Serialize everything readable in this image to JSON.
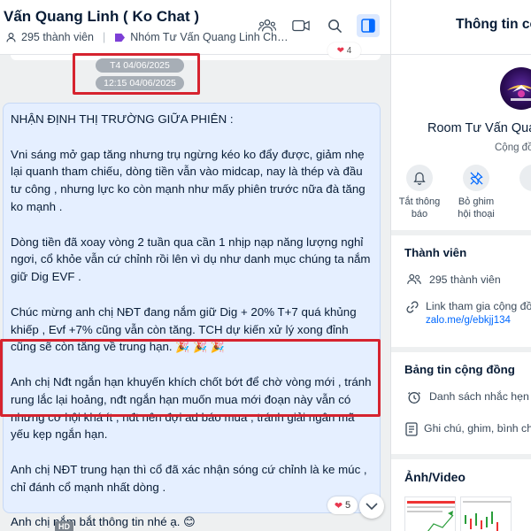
{
  "chat": {
    "title": "Vấn Quang Linh ( Ko Chat )",
    "member_count": "295 thành viên",
    "group_name": "Nhóm Tư Vấn Quang Linh Chứn...",
    "previous_message_reactions": "4",
    "timestamps": [
      "T4 04/06/2025",
      "12:15 04/06/2025"
    ],
    "message": {
      "paragraphs": [
        "NHẬN ĐỊNH THỊ TRƯỜNG GIỮA PHIÊN :",
        "Vni sáng mở gap tăng nhưng trụ ngừng kéo ko đẩy được, giảm nhẹ lại quanh tham chiếu, dòng tiền vẫn vào midcap, nay là thép và đầu tư công , nhưng lực ko còn mạnh như mấy phiên trước nữa đà tăng ko mạnh .",
        "Dòng tiền đã xoay vòng 2 tuần qua cần 1 nhịp nạp năng lượng nghỉ ngơi, cổ khỏe vẫn cứ chỉnh rồi lên vì dụ như danh mục chúng ta nắm giữ Dig EVF .",
        "Chúc mừng anh chị NĐT đang nắm giữ Dig + 20% T+7 quá khủng khiếp , Evf +7% cũng vẫn còn tăng. TCH dự kiến xử lý xong đỉnh cũng sẽ còn tăng về trung hạn.",
        "Anh chị Nđt ngắn hạn khuyến khích chốt bớt để chờ vòng mới , tránh rung lắc lại hoảng, nđt ngắn hạn muốn mua mới đoạn này vẫn có nhưng cơ hội khá ít , nđt nên đợi ad báo mua , tránh giải ngân mã yếu kẹp ngắn hạn.",
        "Anh chị NĐT trung hạn thì cổ đã xác nhận sóng cứ chỉnh là ke múc , chỉ đánh cổ mạnh nhất dòng .",
        "Anh chị nắm bắt thông tin nhé ạ."
      ],
      "celebration_emojis": "🎉 🎉 🎉",
      "smile_emoji": "😊",
      "reaction_count": "5",
      "reaction_icon": "❤️"
    },
    "media_tag": "HD"
  },
  "info_panel": {
    "title": "Thông tin cộng",
    "room_name": "Room Tư Vấn Qua",
    "room_subtitle": "Cộng đồ",
    "actions": [
      {
        "label_line1": "Tắt thông",
        "label_line2": "báo",
        "icon": "bell-icon"
      },
      {
        "label_line1": "Bỏ ghim",
        "label_line2": "hội thoại",
        "icon": "unpin-icon"
      }
    ],
    "members_section": {
      "title": "Thành viên",
      "count": "295 thành viên",
      "invite_label": "Link tham gia cộng đồ",
      "invite_link": "zalo.me/g/ebkjj134"
    },
    "board_section": {
      "title": "Bảng tin cộng đồng",
      "reminders": "Danh sách nhắc hẹn",
      "notes": "Ghi chú, ghim, bình ch"
    },
    "media_section": {
      "title": "Ảnh/Video"
    }
  },
  "colors": {
    "accent_blue": "#0068ff",
    "bubble_bg": "#e5efff",
    "highlight_red": "#d6232f"
  }
}
